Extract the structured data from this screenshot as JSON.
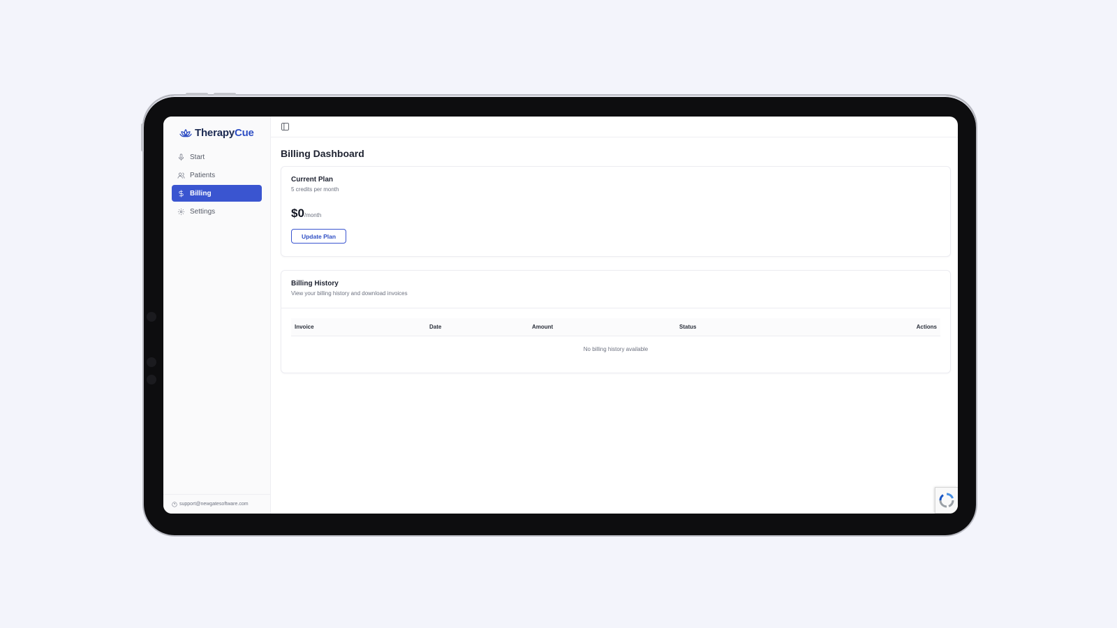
{
  "brand": {
    "name_part1": "Therapy",
    "name_part2": "Cue",
    "logo_icon": "lotus-icon"
  },
  "colors": {
    "accent": "#3a55d0",
    "brand_dark": "#1c2a52",
    "background": "#f3f4fb"
  },
  "sidebar": {
    "items": [
      {
        "label": "Start",
        "icon": "microphone-icon",
        "active": false
      },
      {
        "label": "Patients",
        "icon": "users-icon",
        "active": false
      },
      {
        "label": "Billing",
        "icon": "dollar-icon",
        "active": true
      },
      {
        "label": "Settings",
        "icon": "gear-icon",
        "active": false
      }
    ],
    "footer_email": "support@newgatesoftware.com"
  },
  "topbar": {
    "toggle_icon": "sidebar-toggle-icon"
  },
  "main": {
    "title": "Billing Dashboard",
    "plan": {
      "title": "Current Plan",
      "subtitle": "5 credits per month",
      "price": "$0",
      "period": "/month",
      "button_label": "Update Plan"
    },
    "history": {
      "title": "Billing History",
      "subtitle": "View your billing history and download invoices",
      "columns": [
        "Invoice",
        "Date",
        "Amount",
        "Status",
        "Actions"
      ],
      "empty_message": "No billing history available"
    }
  }
}
